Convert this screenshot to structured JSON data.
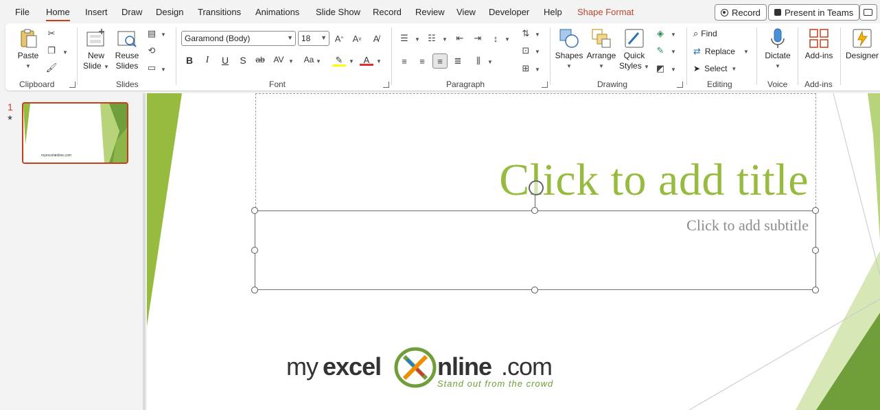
{
  "menu": {
    "tabs": [
      {
        "label": "File"
      },
      {
        "label": "Home"
      },
      {
        "label": "Insert"
      },
      {
        "label": "Draw"
      },
      {
        "label": "Design"
      },
      {
        "label": "Transitions"
      },
      {
        "label": "Animations"
      },
      {
        "label": "Slide Show"
      },
      {
        "label": "Record"
      },
      {
        "label": "Review"
      },
      {
        "label": "View"
      },
      {
        "label": "Developer"
      },
      {
        "label": "Help"
      },
      {
        "label": "Shape Format"
      }
    ],
    "active_tab": "Home",
    "record_button": "Record",
    "present_button": "Present in Teams"
  },
  "ribbon": {
    "clipboard": {
      "paste": "Paste",
      "label": "Clipboard"
    },
    "slides": {
      "new_slide_1": "New",
      "new_slide_2": "Slide",
      "reuse_1": "Reuse",
      "reuse_2": "Slides",
      "label": "Slides"
    },
    "font": {
      "family": "Garamond (Body)",
      "size": "18",
      "label": "Font"
    },
    "paragraph": {
      "label": "Paragraph"
    },
    "drawing": {
      "shapes": "Shapes",
      "arrange": "Arrange",
      "quick_1": "Quick",
      "quick_2": "Styles",
      "label": "Drawing"
    },
    "editing": {
      "find": "Find",
      "replace": "Replace",
      "select": "Select",
      "label": "Editing"
    },
    "voice": {
      "dictate": "Dictate",
      "label": "Voice"
    },
    "addins": {
      "addins": "Add-ins",
      "label": "Add-ins"
    },
    "designer": {
      "designer": "Designer"
    }
  },
  "thumbnails": {
    "number": "1",
    "star": "★"
  },
  "slide": {
    "title_placeholder": "Click to add title",
    "subtitle_placeholder": "Click to add subtitle",
    "logo_my": "my",
    "logo_excel": "excel",
    "logo_nline": "nline",
    "logo_com": ".com",
    "logo_tagline": "Stand out from the crowd"
  },
  "colors": {
    "accent": "#c43e1c",
    "theme_green": "#97bb3f",
    "dark_green": "#6f9e3a"
  }
}
